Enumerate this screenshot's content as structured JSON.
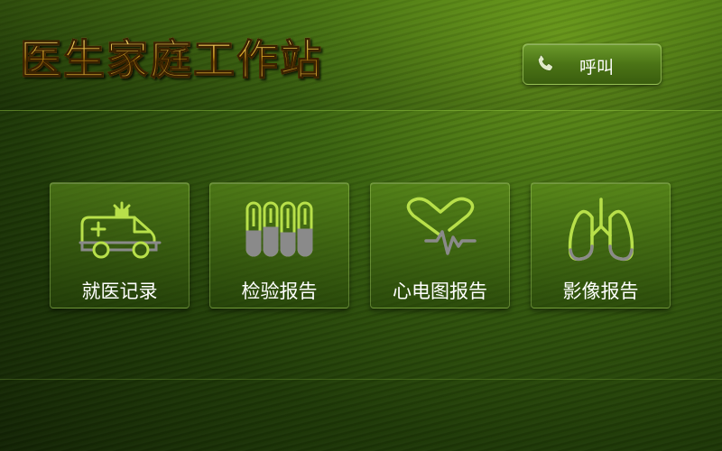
{
  "app": {
    "title": "医生家庭工作站"
  },
  "header": {
    "call_button_label": "呼叫"
  },
  "menu": {
    "tiles": [
      {
        "label": "就医记录",
        "icon": "ambulance-icon"
      },
      {
        "label": "检验报告",
        "icon": "test-tubes-icon"
      },
      {
        "label": "心电图报告",
        "icon": "ecg-heart-icon"
      },
      {
        "label": "影像报告",
        "icon": "lungs-icon"
      }
    ]
  },
  "colors": {
    "accent": "#b8e04a",
    "title_gold": "#e4b02a",
    "icon_gray": "#8a8a8a",
    "background_dark": "#1f3a08"
  }
}
